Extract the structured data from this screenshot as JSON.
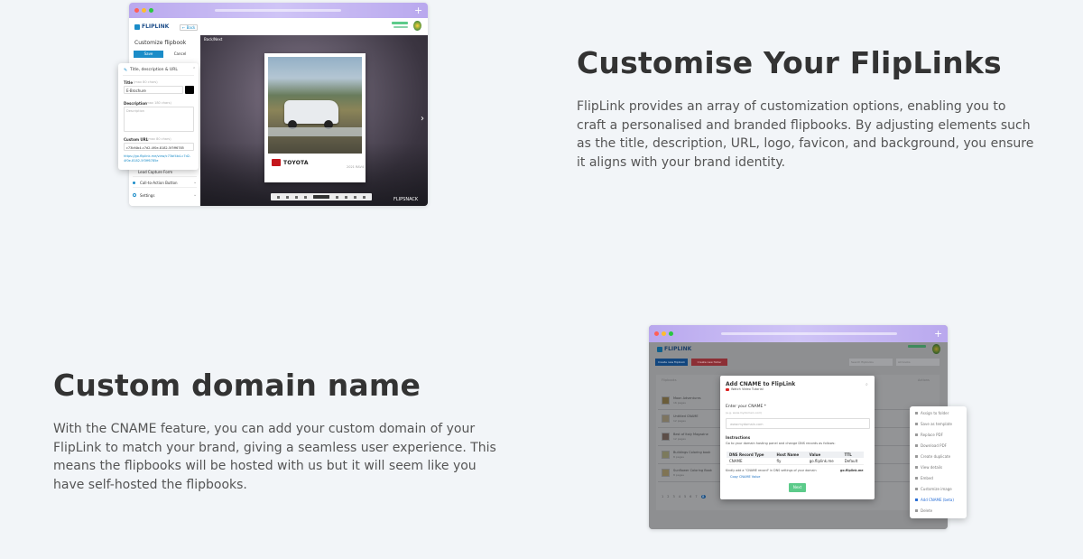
{
  "section1": {
    "title": "Customise Your FlipLinks",
    "description": "FlipLink provides an array of customization options, enabling you to craft a personalised and branded flipbooks. By adjusting elements such as the title, description, URL, logo, favicon, and background, you ensure it aligns with your brand identity."
  },
  "section2": {
    "title": "Custom domain name",
    "description": "With the CNAME feature, you can add your custom domain of your FlipLink to match your brand, giving a seamless user experience. This means the flipbooks will be hosted with us but it will seem like you have self-hosted the flipbooks."
  },
  "mock1": {
    "brand": "FLIPLINK",
    "back_label": "← Back",
    "panel_title": "Customize flipbook",
    "tab_save": "Save",
    "tab_cancel": "Cancel",
    "popup_title": "Title, description & URL",
    "title_label": "Title",
    "title_hint": "(max 80 chars)",
    "title_value": "E-Brochure",
    "description_label": "Description",
    "description_hint": "(max 180 chars)",
    "description_placeholder": "Description",
    "url_label": "Custom URL",
    "url_hint": "(max 80 chars)",
    "url_value": "c73bf4b4-c7d2-4f0e-8182-5f3ff6785",
    "url_link": "https://go.fliplink.me/view/c73bf4b4-c7d2-4f0e-8182-5f3ff6785e",
    "menu_lead": "Lead Capture Form",
    "menu_cta": "Call-to-Action Button",
    "menu_settings": "Settings",
    "canvas_label": "Back/Next",
    "page_brand": "TOYOTA",
    "page_note": "2021 RAV4",
    "watermark": "FLIPSNACK",
    "colors": {
      "accent": "#1a8cc8",
      "window_bar": "#c5b8f3",
      "toyota_red": "#c4161c"
    }
  },
  "mock2": {
    "brand": "FLIPLINK",
    "btn_primary": "Create new flipbook",
    "btn_danger": "Create new folder",
    "search_placeholder": "Search flipbooks",
    "sort_label": "All books",
    "list_header_left": "Flipbooks",
    "list_header_right": "Actions",
    "rows": [
      {
        "title": "Moon Adventures",
        "meta": "16 pages"
      },
      {
        "title": "Untitled CNAME",
        "meta": "12 pages"
      },
      {
        "title": "Best of Italy Magazine",
        "meta": "12 pages"
      },
      {
        "title": "Buildings Coloring book",
        "meta": "8 pages"
      },
      {
        "title": "Sunflower Coloring Book",
        "meta": "8 pages"
      }
    ],
    "modal_title": "Add CNAME to FlipLink",
    "modal_video": "Watch Video Tutorial",
    "modal_field_label": "Enter your CNAME *",
    "modal_field_hint": "(e.g. www.mydomain.com)",
    "modal_field_placeholder": "www.mydomain.com",
    "instructions_title": "Instructions",
    "instructions_text": "Go to your domain hosting panel and change DNS records as follows:",
    "table_headers": [
      "DNS Record Type",
      "Host Name",
      "Value",
      "TTL"
    ],
    "table_rows": [
      [
        "CNAME",
        "fly",
        "go.fliplink.me",
        "Default"
      ]
    ],
    "instructions_footer_pre": "Kindly add a \"CNAME record\" in DNS settings of your domain",
    "instructions_footer_domain": "go.fliplink.me",
    "copy_label": "Copy CNAME Value",
    "next_label": "Next",
    "menu_items": [
      "Assign to folder",
      "Save as template",
      "Replace PDF",
      "Download PDF",
      "Create duplicate",
      "View details",
      "Embed",
      "Customize image",
      "Add CNAME (beta)",
      "Delete"
    ],
    "pagination": [
      "1",
      "2",
      "3",
      "4",
      "5",
      "6",
      "7",
      "8"
    ],
    "colors": {
      "primary_btn": "#1a6fc2",
      "danger_btn": "#d84a4a",
      "next_btn": "#5ccb8a",
      "active_menu": "#2a6fd6"
    }
  }
}
